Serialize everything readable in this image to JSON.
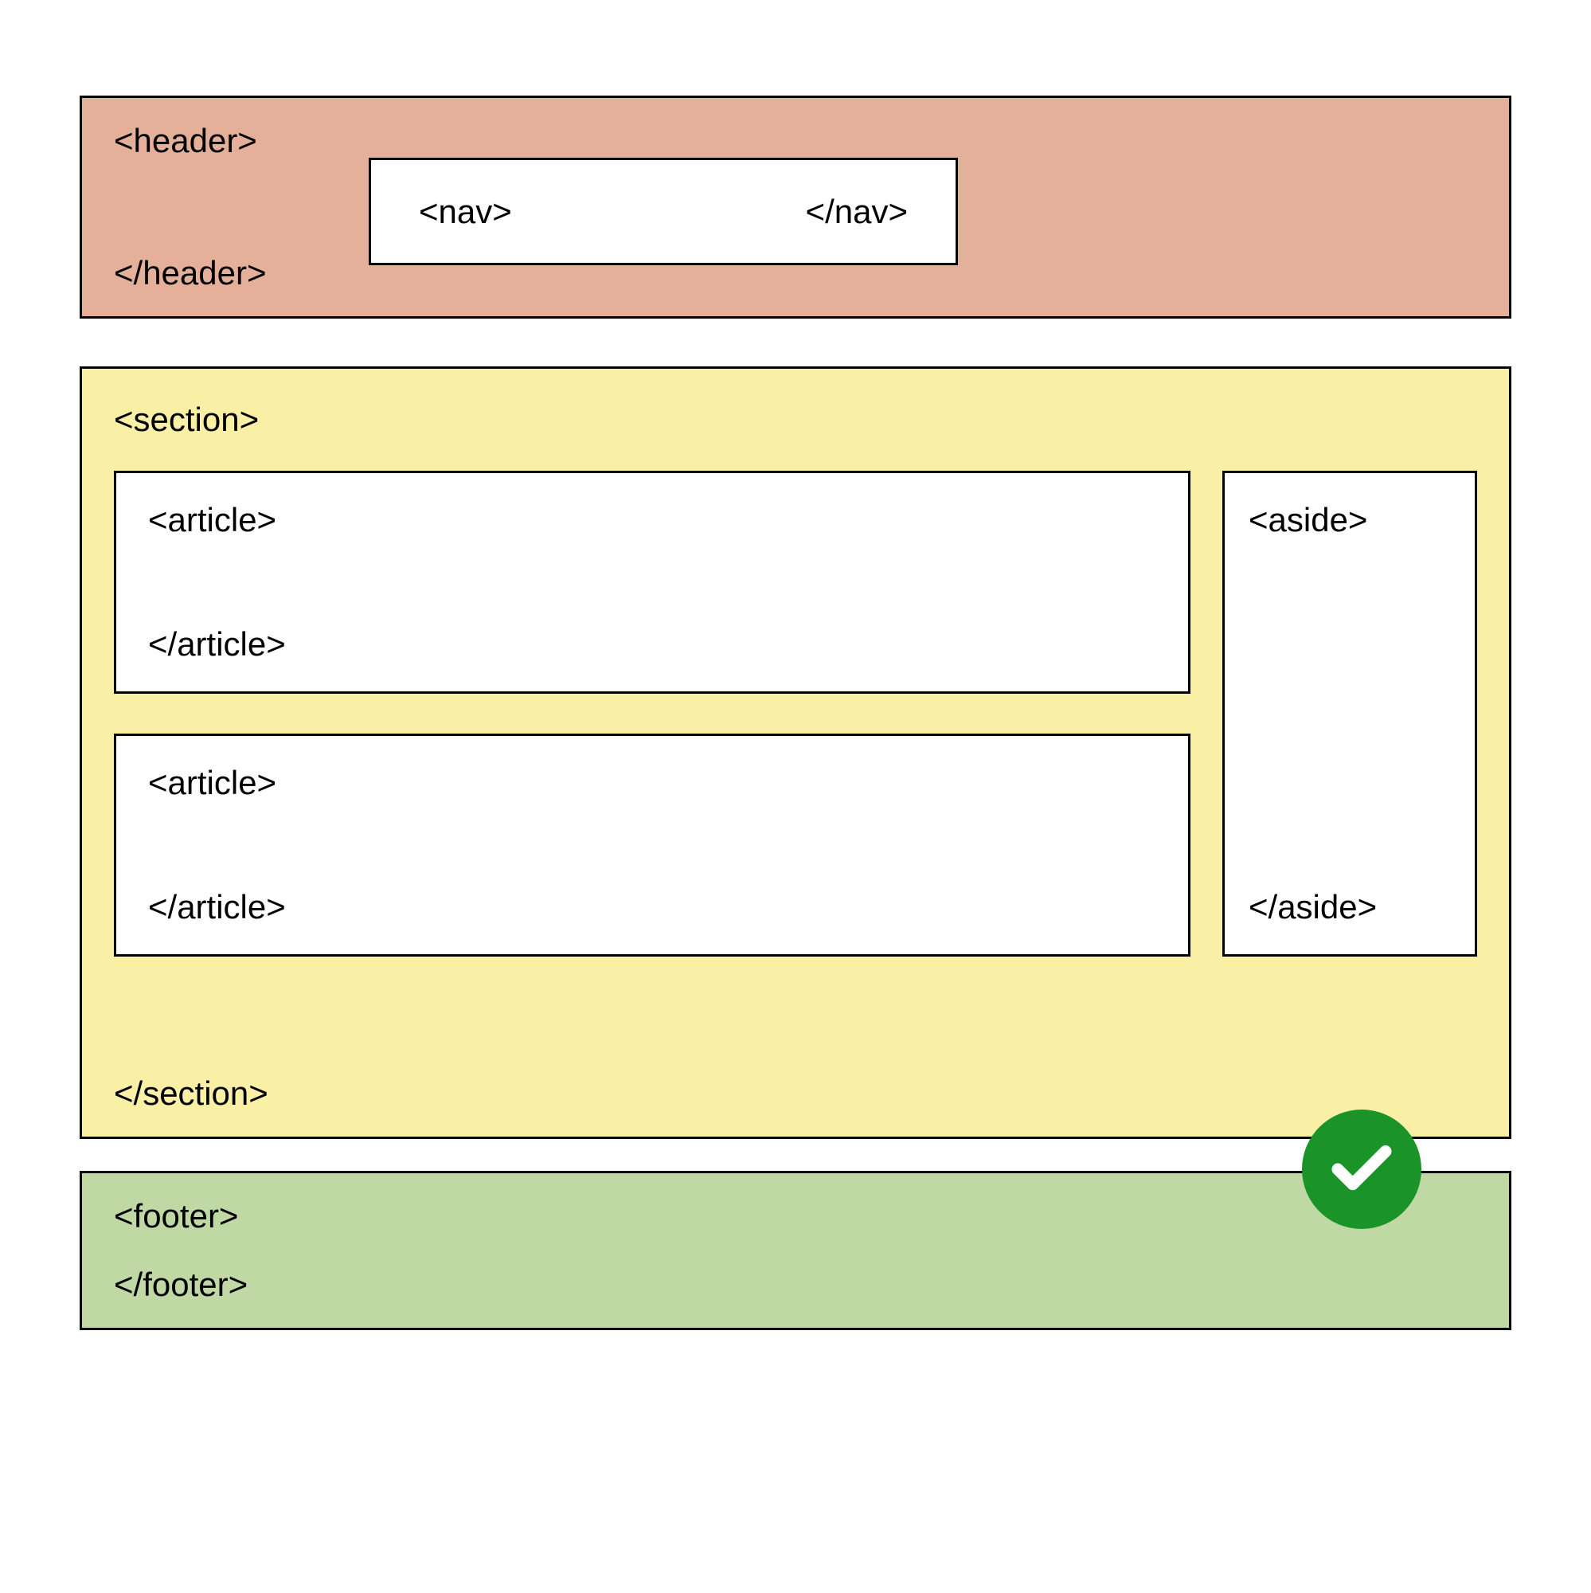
{
  "header": {
    "open_tag": "<header>",
    "close_tag": "</header>",
    "nav": {
      "open_tag": "<nav>",
      "close_tag": "</nav>"
    }
  },
  "section": {
    "open_tag": "<section>",
    "close_tag": "</section>",
    "articles": [
      {
        "open_tag": "<article>",
        "close_tag": "</article>"
      },
      {
        "open_tag": "<article>",
        "close_tag": "</article>"
      }
    ],
    "aside": {
      "open_tag": "<aside>",
      "close_tag": "</aside>"
    }
  },
  "footer": {
    "open_tag": "<footer>",
    "close_tag": "</footer>"
  },
  "badge": {
    "icon": "checkmark-icon",
    "color": "#1a9428"
  },
  "colors": {
    "header_bg": "#e5b09a",
    "section_bg": "#f9f0a5",
    "footer_bg": "#c0d8a4",
    "inner_bg": "#ffffff"
  }
}
